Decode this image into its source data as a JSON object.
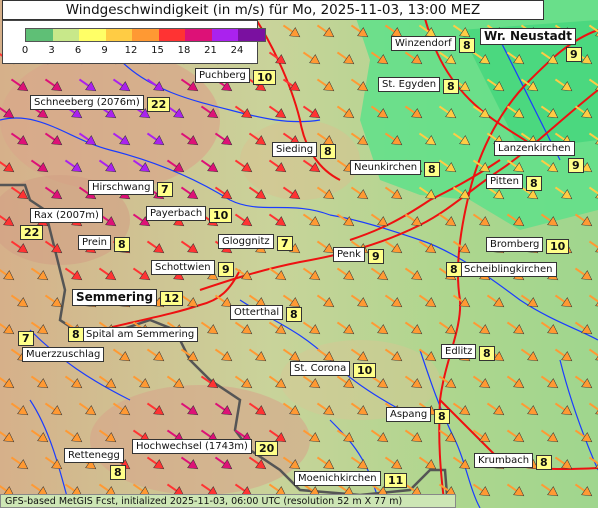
{
  "title": "Windgeschwindigkeit (in m/s) für Mo, 2025-11-03, 13:00 MEZ",
  "legend": {
    "ticks": [
      "0",
      "3",
      "6",
      "9",
      "12",
      "15",
      "18",
      "21",
      "24"
    ],
    "colors": [
      "#5fbf76",
      "#c8e88a",
      "#ffff66",
      "#ffcc44",
      "#ff9933",
      "#ff3333",
      "#dd1177",
      "#aa22ee",
      "#7a10a0"
    ]
  },
  "places": [
    {
      "name": "Winzendorf",
      "speed": "8"
    },
    {
      "name": "Wr. Neustadt",
      "speed": "9"
    },
    {
      "name": "Puchberg",
      "speed": "10"
    },
    {
      "name": "St. Egyden",
      "speed": "8"
    },
    {
      "name": "Schneeberg (2076m)",
      "speed": "22"
    },
    {
      "name": "Sieding",
      "speed": "8"
    },
    {
      "name": "Neunkirchen",
      "speed": "8"
    },
    {
      "name": "Lanzenkirchen",
      "speed": "9"
    },
    {
      "name": "Hirschwang",
      "speed": "7"
    },
    {
      "name": "Pitten",
      "speed": "8"
    },
    {
      "name": "Payerbach",
      "speed": "10"
    },
    {
      "name": "Rax (2007m)",
      "speed": "22"
    },
    {
      "name": "Prein",
      "speed": "8"
    },
    {
      "name": "Gloggnitz",
      "speed": "7"
    },
    {
      "name": "Bromberg",
      "speed": "10"
    },
    {
      "name": "Penk",
      "speed": "9"
    },
    {
      "name": "Schottwien",
      "speed": "9"
    },
    {
      "name": "Scheiblingkirchen",
      "speed": "8"
    },
    {
      "name": "Semmering",
      "speed": "12"
    },
    {
      "name": "Otterthal",
      "speed": "8"
    },
    {
      "name": "Spital am Semmering",
      "speed": "8"
    },
    {
      "name": "Muerzzuschlag",
      "speed": "7"
    },
    {
      "name": "Edlitz",
      "speed": "8"
    },
    {
      "name": "St. Corona",
      "speed": "10"
    },
    {
      "name": "Aspang",
      "speed": "8"
    },
    {
      "name": "Hochwechsel (1743m)",
      "speed": "20"
    },
    {
      "name": "Krumbach",
      "speed": "8"
    },
    {
      "name": "Rettenegg",
      "speed": "8"
    },
    {
      "name": "Moenichkirchen",
      "speed": "11"
    }
  ],
  "footer": "GFS-based MetGIS Fcst, initialized 2025-11-03, 06:00 UTC  (resolution 52 m X 77 m)"
}
